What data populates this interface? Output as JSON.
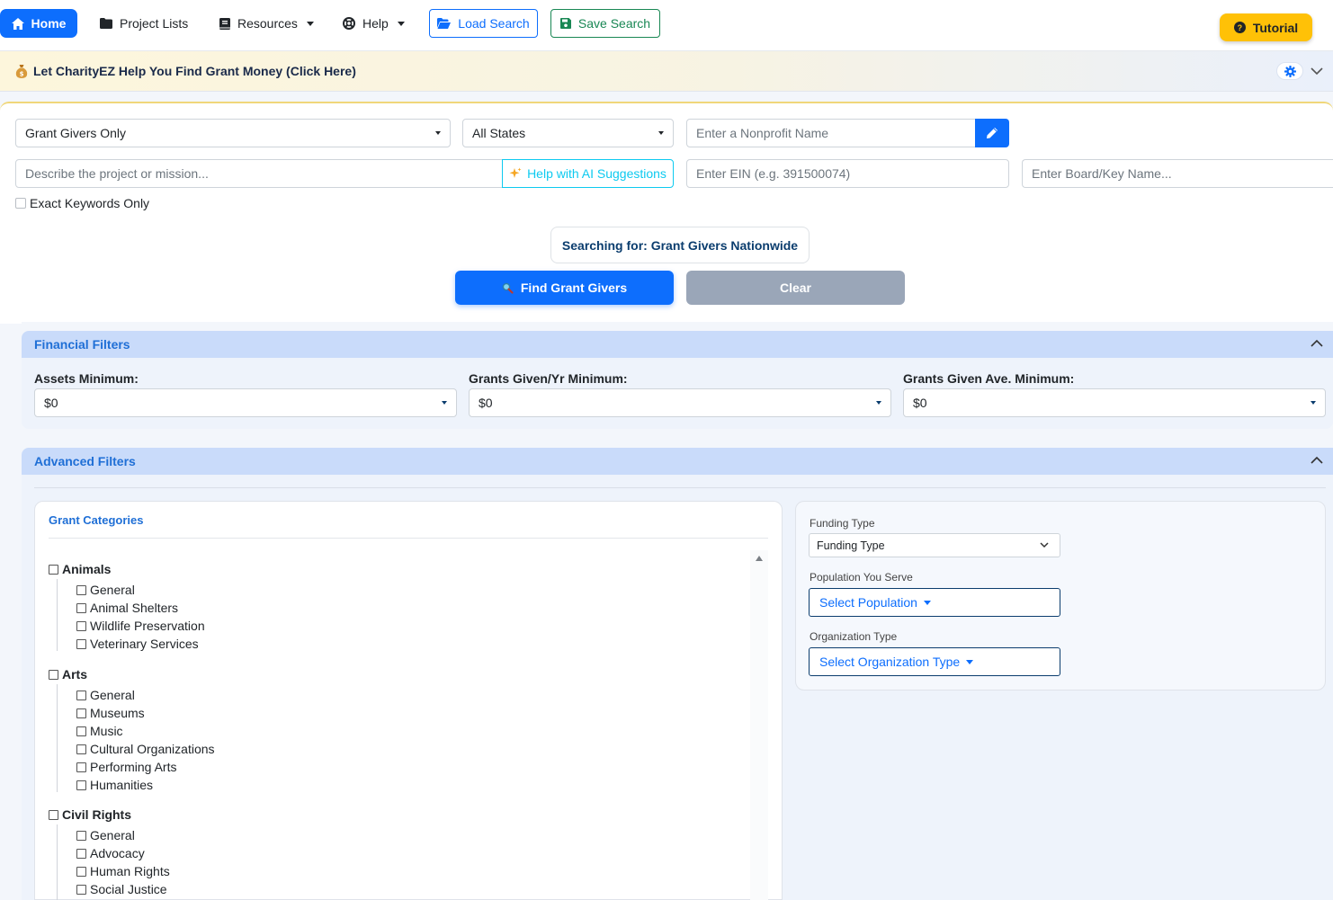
{
  "nav": {
    "home": "Home",
    "project_lists": "Project Lists",
    "resources": "Resources",
    "help": "Help",
    "load_search": "Load Search",
    "save_search": "Save Search",
    "tutorial": "Tutorial"
  },
  "banner": {
    "text": "Let CharityEZ Help You Find Grant Money (Click Here)"
  },
  "search": {
    "type_select": "Grant Givers Only",
    "state_select": "All States",
    "nonprofit_placeholder": "Enter a Nonprofit Name",
    "project_placeholder": "Describe the project or mission...",
    "ai_button": "Help with AI Suggestions",
    "ein_placeholder": "Enter EIN (e.g. 391500074)",
    "board_placeholder": "Enter Board/Key Name...",
    "exact_keywords": "Exact Keywords Only",
    "searching_for": "Searching for: Grant Givers Nationwide",
    "find_button": "Find Grant Givers",
    "clear_button": "Clear"
  },
  "financial": {
    "title": "Financial Filters",
    "filters": [
      {
        "label": "Assets Minimum:",
        "value": "$0"
      },
      {
        "label": "Grants Given/Yr Minimum:",
        "value": "$0"
      },
      {
        "label": "Grants Given Ave. Minimum:",
        "value": "$0"
      }
    ]
  },
  "advanced": {
    "title": "Advanced Filters",
    "categories_title": "Grant Categories",
    "categories": [
      {
        "name": "Animals",
        "subs": [
          "General",
          "Animal Shelters",
          "Wildlife Preservation",
          "Veterinary Services"
        ]
      },
      {
        "name": "Arts",
        "subs": [
          "General",
          "Museums",
          "Music",
          "Cultural Organizations",
          "Performing Arts",
          "Humanities"
        ]
      },
      {
        "name": "Civil Rights",
        "subs": [
          "General",
          "Advocacy",
          "Human Rights",
          "Social Justice"
        ]
      }
    ],
    "funding_type_label": "Funding Type",
    "funding_type_value": "Funding Type",
    "population_label": "Population You Serve",
    "population_button": "Select Population",
    "org_type_label": "Organization Type",
    "org_type_button": "Select Organization Type"
  },
  "colors": {
    "primary": "#0d6efd",
    "success": "#198754",
    "warning": "#ffc107",
    "info": "#0dcaf0",
    "section_header": "#c9dbfa"
  }
}
